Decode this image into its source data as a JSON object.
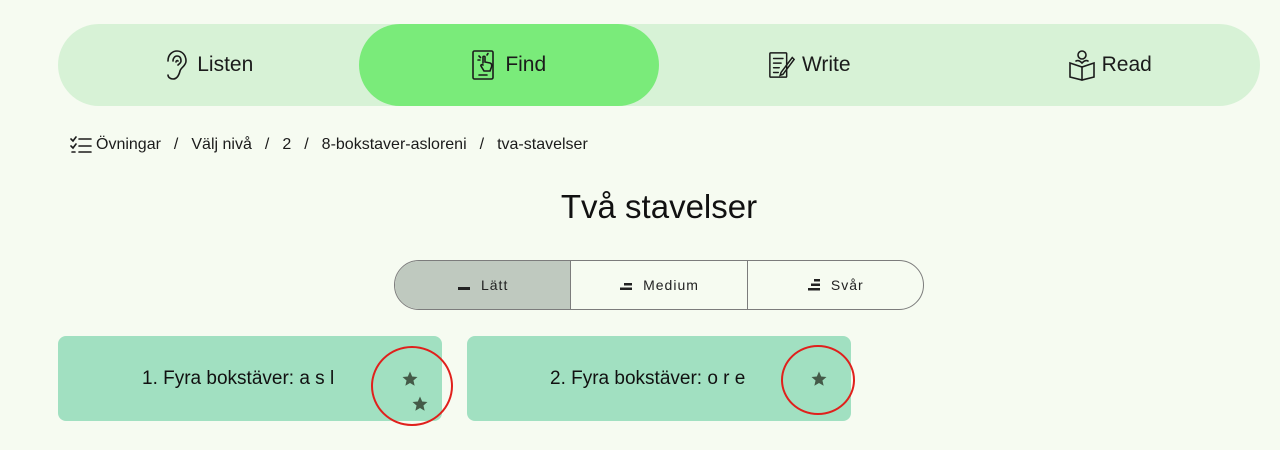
{
  "tabs": [
    {
      "label": "Listen",
      "icon": "ear-icon",
      "active": false
    },
    {
      "label": "Find",
      "icon": "tap-tablet-icon",
      "active": true
    },
    {
      "label": "Write",
      "icon": "write-icon",
      "active": false
    },
    {
      "label": "Read",
      "icon": "reading-person-icon",
      "active": false
    }
  ],
  "breadcrumb": {
    "icon": "checklist-icon",
    "items": [
      "Övningar",
      "Välj nivå",
      "2",
      "8-bokstaver-asloreni",
      "tva-stavelser"
    ],
    "separator": "/"
  },
  "title": "Två stavelser",
  "levels": [
    {
      "label": "Lätt",
      "active": true
    },
    {
      "label": "Medium",
      "active": false
    },
    {
      "label": "Svår",
      "active": false
    }
  ],
  "exercises": [
    {
      "label": "1. Fyra bokstäver: a s l",
      "stars": 2
    },
    {
      "label": "2. Fyra bokstäver: o r e",
      "stars": 1
    }
  ],
  "colors": {
    "tab_bar": "#d7f2d6",
    "tab_active": "#7aeb7a",
    "card": "#a1e0c1",
    "level_active": "#bfc9bf",
    "star": "#445a48",
    "highlight_ring": "#e0201c"
  }
}
